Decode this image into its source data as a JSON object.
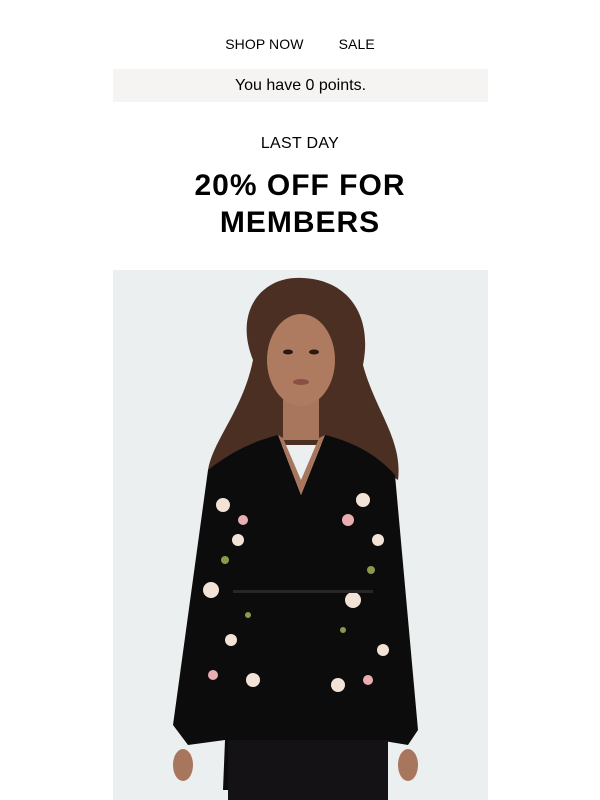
{
  "nav": {
    "items": [
      {
        "label": "SHOP NOW"
      },
      {
        "label": "SALE"
      }
    ]
  },
  "points": {
    "text": "You have 0 points."
  },
  "promo": {
    "eyebrow": "LAST DAY",
    "headline": "20% OFF FOR MEMBERS"
  },
  "hero": {
    "icon": "model-photo",
    "background_color": "#eceff0",
    "garment_color": "#0d0c0d",
    "hair_color": "#4a2f22",
    "skin_color": "#a8765c"
  }
}
